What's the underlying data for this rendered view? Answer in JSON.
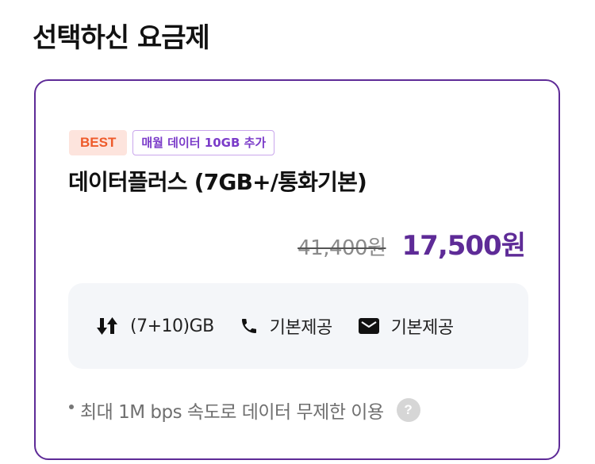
{
  "page": {
    "title": "선택하신 요금제"
  },
  "plan": {
    "badges": {
      "best": "BEST",
      "extra": "매월 데이터 10GB 추가"
    },
    "name": "데이터플러스 (7GB+/통화기본)",
    "price_original": "41,400원",
    "price_sale": "17,500원",
    "benefits": [
      {
        "icon": "data-arrows-icon",
        "text": "(7+10)GB"
      },
      {
        "icon": "phone-icon",
        "text": "기본제공"
      },
      {
        "icon": "mail-icon",
        "text": "기본제공"
      }
    ],
    "note": "최대 1M bps 속도로 데이터 무제한 이용",
    "help_symbol": "?"
  },
  "colors": {
    "brand_purple": "#5e2b97",
    "best_badge_text": "#ee5a2a",
    "best_badge_bg": "#fde4dd",
    "extra_badge_text": "#7b3cc9"
  }
}
